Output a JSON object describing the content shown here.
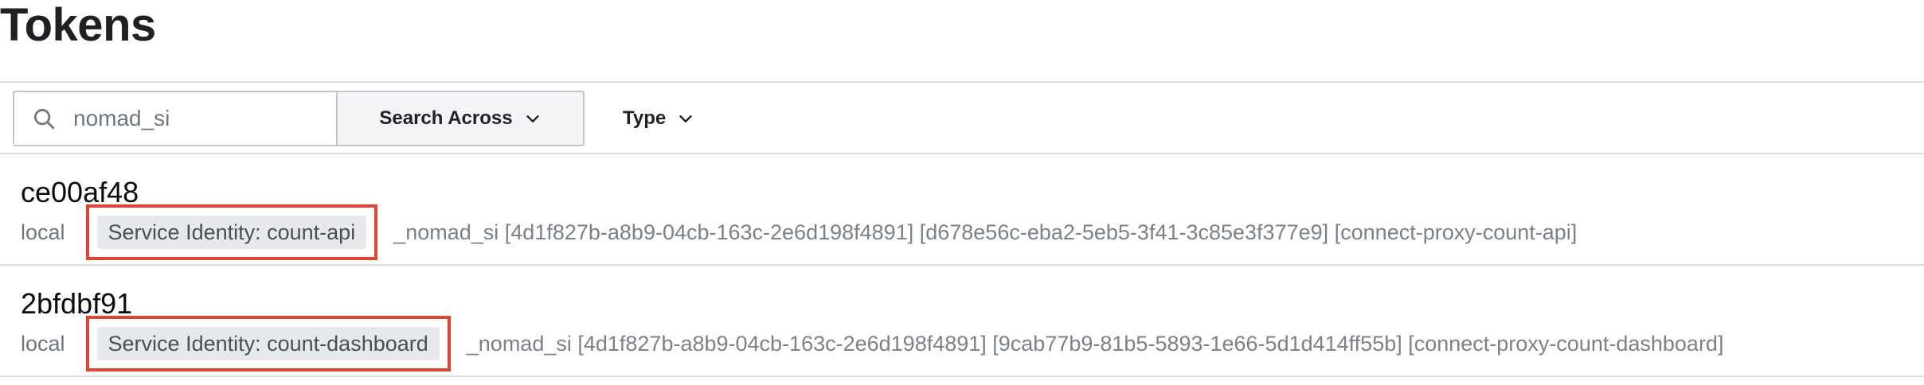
{
  "page": {
    "title": "Tokens"
  },
  "search": {
    "value": "",
    "placeholder": "nomad_si",
    "search_across_label": "Search Across"
  },
  "filters": {
    "type_label": "Type"
  },
  "tokens": [
    {
      "accessor": "ce00af48",
      "scope": "local",
      "badge": "Service Identity: count-api",
      "description": "_nomad_si [4d1f827b-a8b9-04cb-163c-2e6d198f4891] [d678e56c-eba2-5eb5-3f41-3c85e3f377e9] [connect-proxy-count-api]"
    },
    {
      "accessor": "2bfdbf91",
      "scope": "local",
      "badge": "Service Identity: count-dashboard",
      "description": "_nomad_si [4d1f827b-a8b9-04cb-163c-2e6d198f4891] [9cab77b9-81b5-5893-1e66-5d1d414ff55b] [connect-proxy-count-dashboard]"
    }
  ],
  "colors": {
    "highlight_outline": "#e5412d",
    "badge_bg": "#e6e8eb",
    "muted_text": "#6f7682"
  },
  "icons": {
    "search": "search-icon",
    "dropdown": "chevron-down-icon"
  }
}
